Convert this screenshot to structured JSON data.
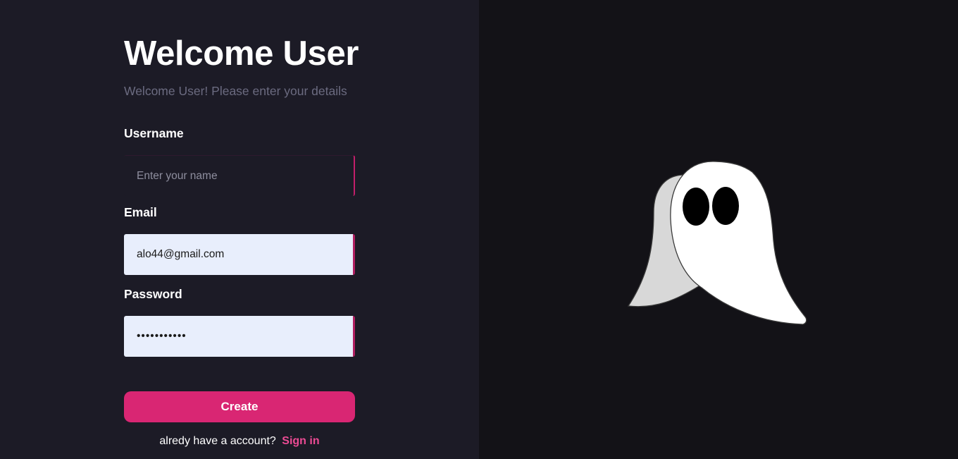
{
  "form": {
    "title": "Welcome User",
    "subtitle": "Welcome User! Please enter your details",
    "username": {
      "label": "Username",
      "value": "",
      "placeholder": "Enter your name"
    },
    "email": {
      "label": "Email",
      "value": "alo44@gmail.com",
      "placeholder": ""
    },
    "password": {
      "label": "Password",
      "value": "•••••••••••"
    },
    "create_label": "Create",
    "signin_prompt": "alredy have a account?",
    "signin_link": "Sign in"
  },
  "illustration": {
    "icon": "ghost-icon"
  },
  "colors": {
    "left_bg": "#1c1b26",
    "right_bg": "#131217",
    "accent": "#d92673",
    "link": "#ec4b94",
    "input_fill": "#e8eefc"
  }
}
